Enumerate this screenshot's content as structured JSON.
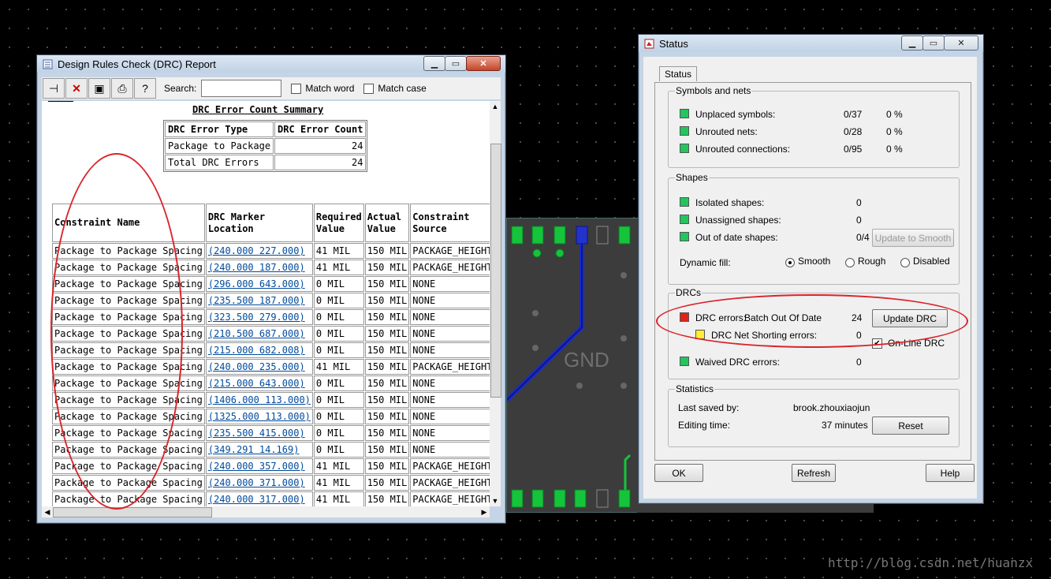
{
  "pcb": {
    "label": "GND"
  },
  "drc_window": {
    "title": "Design Rules Check (DRC) Report",
    "toolbar": {
      "search_label": "Search:",
      "search_value": "",
      "match_word": "Match word",
      "match_case": "Match case",
      "icons": [
        "pin-icon",
        "delete-icon",
        "save-icon",
        "print-icon",
        "help-icon"
      ]
    },
    "summary": {
      "title": "DRC Error Count Summary",
      "headers": [
        "DRC Error Type",
        "DRC Error Count"
      ],
      "rows": [
        [
          "Package to Package",
          "24"
        ],
        [
          "Total DRC Errors",
          "24"
        ]
      ]
    },
    "details": {
      "headers": [
        "Constraint Name",
        "DRC Marker Location",
        "Required Value",
        "Actual Value",
        "Constraint Source"
      ],
      "rows": [
        [
          "Package to Package Spacing",
          "(240.000 227.000)",
          "41 MIL",
          "150 MIL",
          "PACKAGE_HEIGHT_I"
        ],
        [
          "Package to Package Spacing",
          "(240.000 187.000)",
          "41 MIL",
          "150 MIL",
          "PACKAGE_HEIGHT_I"
        ],
        [
          "Package to Package Spacing",
          "(296.000 643.000)",
          "0 MIL",
          "150 MIL",
          "NONE"
        ],
        [
          "Package to Package Spacing",
          "(235.500 187.000)",
          "0 MIL",
          "150 MIL",
          "NONE"
        ],
        [
          "Package to Package Spacing",
          "(323.500 279.000)",
          "0 MIL",
          "150 MIL",
          "NONE"
        ],
        [
          "Package to Package Spacing",
          "(210.500 687.000)",
          "0 MIL",
          "150 MIL",
          "NONE"
        ],
        [
          "Package to Package Spacing",
          "(215.000 682.008)",
          "0 MIL",
          "150 MIL",
          "NONE"
        ],
        [
          "Package to Package Spacing",
          "(240.000 235.000)",
          "41 MIL",
          "150 MIL",
          "PACKAGE_HEIGHT_I"
        ],
        [
          "Package to Package Spacing",
          "(215.000 643.000)",
          "0 MIL",
          "150 MIL",
          "NONE"
        ],
        [
          "Package to Package Spacing",
          "(1406.000 113.000)",
          "0 MIL",
          "150 MIL",
          "NONE"
        ],
        [
          "Package to Package Spacing",
          "(1325.000 113.000)",
          "0 MIL",
          "150 MIL",
          "NONE"
        ],
        [
          "Package to Package Spacing",
          "(235.500 415.000)",
          "0 MIL",
          "150 MIL",
          "NONE"
        ],
        [
          "Package to Package Spacing",
          "(349.291 14.169)",
          "0 MIL",
          "150 MIL",
          "NONE"
        ],
        [
          "Package to Package Spacing",
          "(240.000 357.000)",
          "41 MIL",
          "150 MIL",
          "PACKAGE_HEIGHT_I"
        ],
        [
          "Package to Package Spacing",
          "(240.000 371.000)",
          "41 MIL",
          "150 MIL",
          "PACKAGE_HEIGHT_I"
        ],
        [
          "Package to Package Spacing",
          "(240.000 317.000)",
          "41 MIL",
          "150 MIL",
          "PACKAGE_HEIGHT_I"
        ]
      ]
    }
  },
  "status_window": {
    "title": "Status",
    "tab": "Status",
    "symbols_nets": {
      "title": "Symbols and nets",
      "rows": [
        {
          "label": "Unplaced symbols:",
          "count": "0/37",
          "pct": "0 %"
        },
        {
          "label": "Unrouted nets:",
          "count": "0/28",
          "pct": "0 %"
        },
        {
          "label": "Unrouted connections:",
          "count": "0/95",
          "pct": "0 %"
        }
      ]
    },
    "shapes": {
      "title": "Shapes",
      "rows": [
        {
          "label": "Isolated shapes:",
          "count": "0"
        },
        {
          "label": "Unassigned shapes:",
          "count": "0"
        },
        {
          "label": "Out of date shapes:",
          "count": "0/4"
        }
      ],
      "update_button": "Update to Smooth",
      "dynamic_fill_label": "Dynamic fill:",
      "fill_options": [
        "Smooth",
        "Rough",
        "Disabled"
      ],
      "fill_selected": "Smooth"
    },
    "drcs": {
      "title": "DRCs",
      "drc_errors_label": "DRC errors:",
      "drc_errors_state": "Batch Out Of Date",
      "drc_errors_count": "24",
      "update_button": "Update DRC",
      "net_shorting_label": "DRC Net Shorting errors:",
      "net_shorting_count": "0",
      "online_drc": "On-Line DRC",
      "waived_label": "Waived DRC errors:",
      "waived_count": "0"
    },
    "statistics": {
      "title": "Statistics",
      "last_saved_label": "Last saved by:",
      "last_saved_value": "brook.zhouxiaojun",
      "editing_time_label": "Editing time:",
      "editing_time_value": "37 minutes",
      "reset_button": "Reset"
    },
    "buttons": {
      "ok": "OK",
      "refresh": "Refresh",
      "help": "Help"
    }
  },
  "watermark": "http://blog.csdn.net/huanzx"
}
